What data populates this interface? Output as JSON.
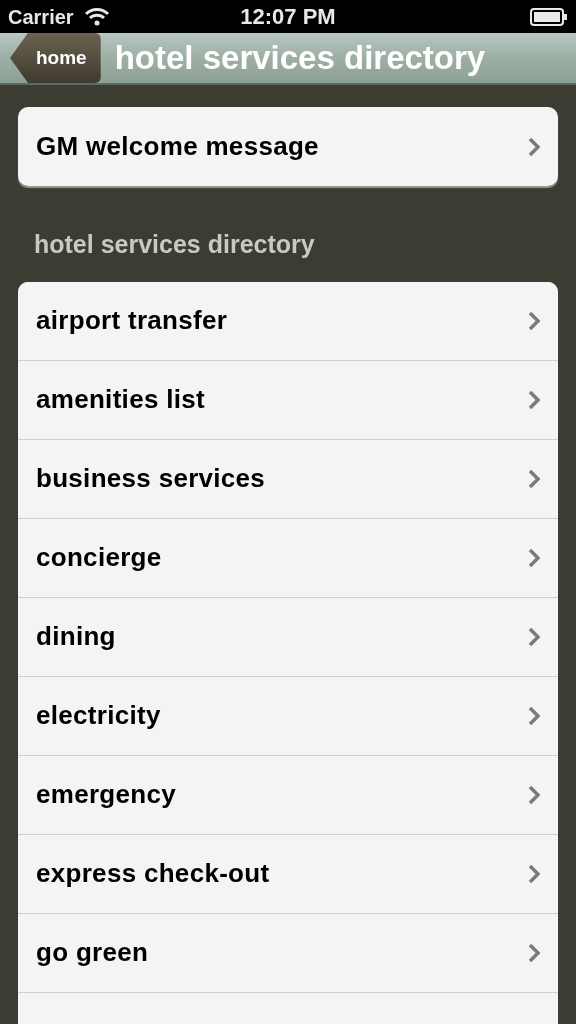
{
  "status_bar": {
    "carrier": "Carrier",
    "time": "12:07 PM"
  },
  "nav_bar": {
    "back_button": "home",
    "title": "hotel services directory"
  },
  "featured": [
    {
      "label": "GM welcome message"
    }
  ],
  "section": {
    "header": "hotel services directory",
    "items": [
      {
        "label": "airport transfer"
      },
      {
        "label": "amenities list"
      },
      {
        "label": "business services"
      },
      {
        "label": "concierge"
      },
      {
        "label": "dining"
      },
      {
        "label": "electricity"
      },
      {
        "label": "emergency"
      },
      {
        "label": "express check-out"
      },
      {
        "label": "go green"
      }
    ]
  }
}
